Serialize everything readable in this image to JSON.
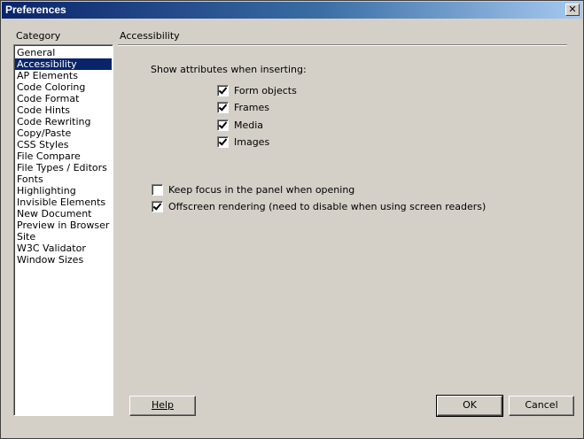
{
  "window": {
    "title": "Preferences",
    "close_symbol": "✕"
  },
  "category": {
    "label": "Category",
    "items": [
      "General",
      "Accessibility",
      "AP Elements",
      "Code Coloring",
      "Code Format",
      "Code Hints",
      "Code Rewriting",
      "Copy/Paste",
      "CSS Styles",
      "File Compare",
      "File Types / Editors",
      "Fonts",
      "Highlighting",
      "Invisible Elements",
      "New Document",
      "Preview in Browser",
      "Site",
      "W3C Validator",
      "Window Sizes"
    ],
    "selected": "Accessibility"
  },
  "accessibility": {
    "title": "Accessibility",
    "show_attributes_label": "Show attributes when inserting:",
    "attributes": [
      {
        "label": "Form objects",
        "checked": true
      },
      {
        "label": "Frames",
        "checked": true
      },
      {
        "label": "Media",
        "checked": true
      },
      {
        "label": "Images",
        "checked": true
      }
    ],
    "keep_focus": {
      "label": "Keep focus in the panel when opening",
      "checked": false
    },
    "offscreen": {
      "label": "Offscreen rendering (need to disable when using screen readers)",
      "checked": true
    }
  },
  "buttons": {
    "help": "Help",
    "ok": "OK",
    "cancel": "Cancel"
  },
  "colors": {
    "selection": "#0a246a",
    "face": "#d4d0c8"
  }
}
